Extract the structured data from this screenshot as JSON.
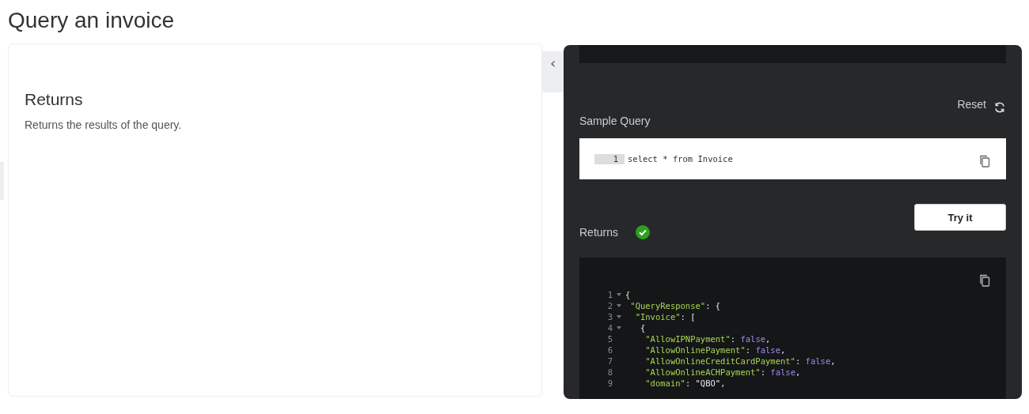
{
  "page": {
    "title": "Query an invoice"
  },
  "returns_section": {
    "heading": "Returns",
    "description": "Returns the results of the query."
  },
  "panel_toggle": {
    "icon": "‹"
  },
  "console": {
    "reset_label": "Reset",
    "sample_query_label": "Sample Query",
    "query_editor": {
      "lines": [
        {
          "number": "1",
          "text": "select * from Invoice"
        }
      ]
    },
    "try_button": "Try it",
    "returns_label": "Returns",
    "success": true,
    "response": {
      "lines": [
        {
          "number": "1",
          "foldable": true,
          "text": "{"
        },
        {
          "number": "2",
          "foldable": true,
          "text": " \"QueryResponse\": {"
        },
        {
          "number": "3",
          "foldable": true,
          "text": "  \"Invoice\": ["
        },
        {
          "number": "4",
          "foldable": true,
          "text": "   {"
        },
        {
          "number": "5",
          "foldable": false,
          "text": "    \"AllowIPNPayment\": false,"
        },
        {
          "number": "6",
          "foldable": false,
          "text": "    \"AllowOnlinePayment\": false,"
        },
        {
          "number": "7",
          "foldable": false,
          "text": "    \"AllowOnlineCreditCardPayment\": false,"
        },
        {
          "number": "8",
          "foldable": false,
          "text": "    \"AllowOnlineACHPayment\": false,"
        },
        {
          "number": "9",
          "foldable": false,
          "text": "    \"domain\": \"QBO\","
        }
      ]
    }
  }
}
